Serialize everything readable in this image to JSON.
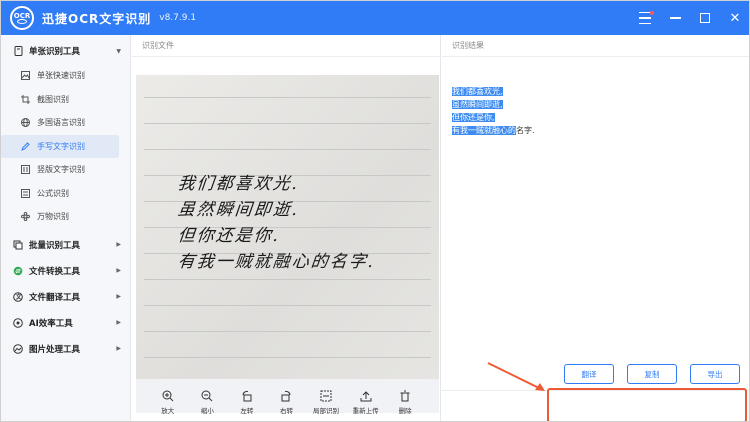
{
  "titlebar": {
    "app_name": "迅捷OCR文字识别",
    "version": "v8.7.9.1",
    "logo_text": "OCR"
  },
  "sidebar": {
    "groups": [
      {
        "label": "单张识别工具",
        "icon": "doc-icon",
        "expanded": true,
        "items": [
          {
            "label": "单张快速识别",
            "icon": "image-icon"
          },
          {
            "label": "截图识别",
            "icon": "crop-icon"
          },
          {
            "label": "多国语言识别",
            "icon": "globe-icon"
          },
          {
            "label": "手写文字识别",
            "icon": "pen-icon",
            "active": true
          },
          {
            "label": "竖版文字识别",
            "icon": "vertical-text-icon"
          },
          {
            "label": "公式识别",
            "icon": "formula-icon"
          },
          {
            "label": "万物识别",
            "icon": "flower-icon"
          }
        ]
      },
      {
        "label": "批量识别工具",
        "icon": "layers-icon"
      },
      {
        "label": "文件转换工具",
        "icon": "convert-icon"
      },
      {
        "label": "文件翻译工具",
        "icon": "translate-icon"
      },
      {
        "label": "AI效率工具",
        "icon": "ai-icon"
      },
      {
        "label": "图片处理工具",
        "icon": "picture-icon"
      }
    ]
  },
  "left_panel": {
    "title": "识别文件",
    "handwriting": [
      "我们都喜欢光.",
      "虽然瞬间即逝.",
      "但你还是你.",
      "有我一贼就融心的名字."
    ],
    "tools": [
      "放大",
      "缩小",
      "左转",
      "右转",
      "局部识别",
      "重新上传",
      "删除"
    ]
  },
  "right_panel": {
    "title": "识别结果",
    "lines": [
      "我们都喜欢光,",
      "虽然瞬间即逝,",
      "但你还是你,",
      "有我一贼就融心的"
    ],
    "unselected_tail": "名字.",
    "buttons": {
      "translate": "翻译",
      "copy": "复制",
      "export": "导出"
    }
  },
  "colors": {
    "accent": "#2f7cf6",
    "annotation": "#ef5a36",
    "selection": "#3e8cf2"
  }
}
